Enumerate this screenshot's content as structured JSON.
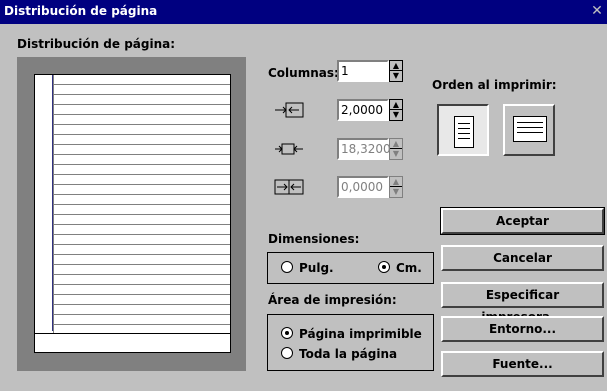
{
  "window": {
    "title": "Distribución de página",
    "close_glyph": "✕"
  },
  "preview": {
    "label": "Distribución de página:"
  },
  "columns": {
    "label": "Columnas:",
    "value": "1"
  },
  "spacing": [
    {
      "icon": "column-margin-icon",
      "value": "2,0000",
      "disabled": false
    },
    {
      "icon": "column-width-icon",
      "value": "18,3200",
      "disabled": true
    },
    {
      "icon": "column-gutter-icon",
      "value": "0,0000",
      "disabled": true
    }
  ],
  "print_order": {
    "label": "Orden al imprimir:"
  },
  "dimensions": {
    "label": "Dimensiones:",
    "options": [
      "Pulg.",
      "Cm."
    ],
    "selected": "Cm."
  },
  "print_area": {
    "label": "Área de impresión:",
    "options": [
      "Página imprimible",
      "Toda la página"
    ],
    "selected": "Página imprimible"
  },
  "buttons": {
    "accept": "Aceptar",
    "cancel": "Cancelar",
    "printer": "Especificar impresora...",
    "environment": "Entorno...",
    "font": "Fuente..."
  },
  "colors": {
    "titlebar": "#000080",
    "face": "#c0c0c0",
    "preview_bg": "#808080"
  }
}
